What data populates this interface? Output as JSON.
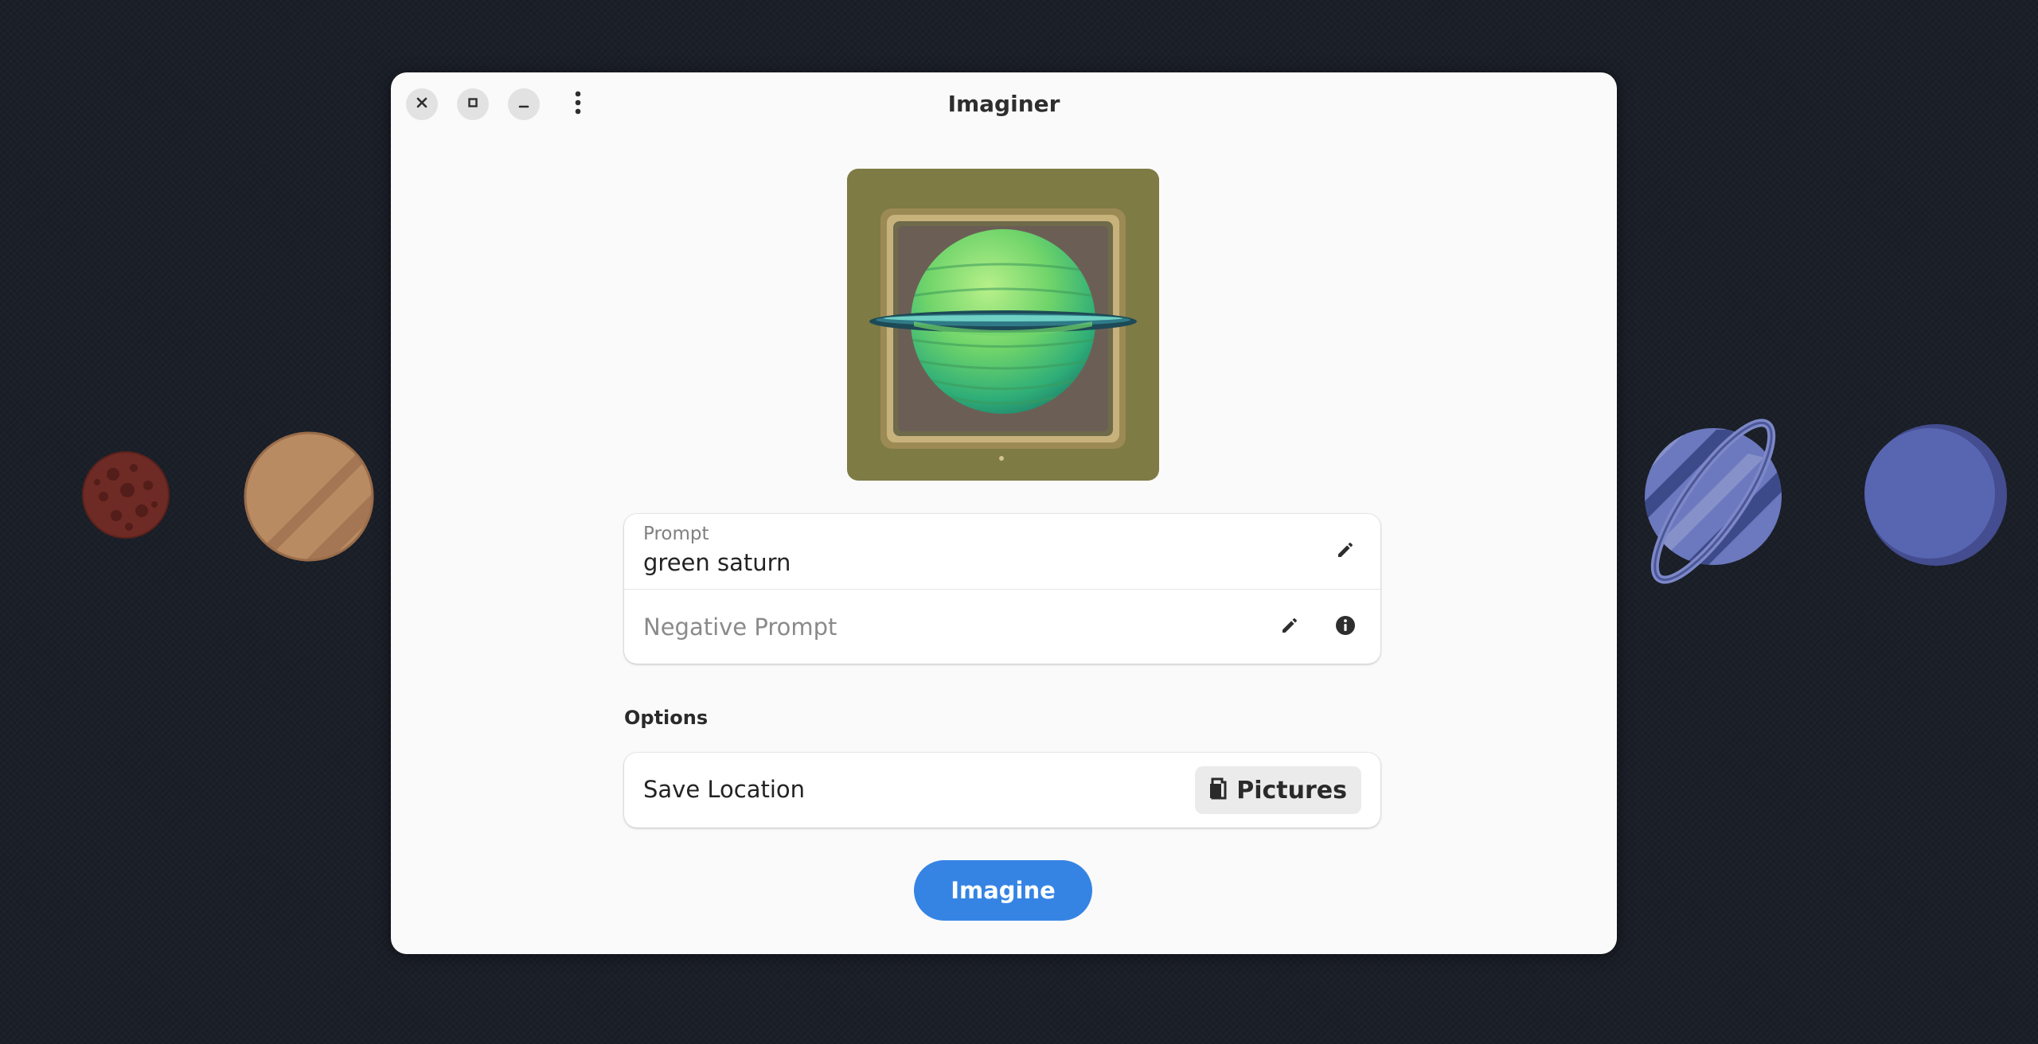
{
  "window": {
    "title": "Imaginer",
    "controls": {
      "close_icon": "close-icon",
      "maximize_icon": "maximize-icon",
      "minimize_icon": "minimize-icon",
      "menu_icon": "vertical-dots-menu-icon"
    }
  },
  "preview": {
    "icon": "generated-image-green-saturn"
  },
  "prompt_card": {
    "prompt": {
      "subtitle": "Prompt",
      "value": "green saturn",
      "edit_icon": "pencil-icon"
    },
    "negative_prompt": {
      "placeholder": "Negative Prompt",
      "edit_icon": "pencil-icon",
      "info_icon": "info-icon"
    }
  },
  "options": {
    "heading": "Options",
    "save_location": {
      "title": "Save Location",
      "button_label": "Pictures",
      "button_icon": "folder-icon"
    }
  },
  "actions": {
    "imagine_label": "Imagine"
  },
  "colors": {
    "accent": "#3584e4",
    "window_bg": "#fafafa",
    "desktop_bg": "#1b1f28"
  }
}
